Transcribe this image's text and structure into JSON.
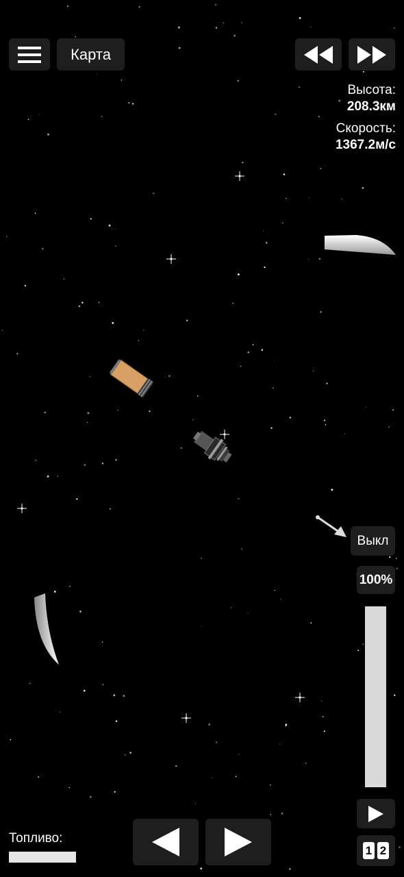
{
  "toolbar": {
    "menu_icon": "hamburger-menu-icon",
    "map_label": "Карта",
    "rewind_icon": "rewind-icon",
    "fast_forward_icon": "fast-forward-icon"
  },
  "telemetry": {
    "altitude_label": "Высота:",
    "altitude_value": "208.3км",
    "speed_label": "Скорость:",
    "speed_value": "1367.2м/с"
  },
  "controls": {
    "toggle_label": "Выкл",
    "throttle_label": "100%",
    "throttle_level": 1.0,
    "play_icon": "play-icon",
    "stage_digits": [
      "1",
      "2"
    ],
    "rotate_left_icon": "rotate-left-arrow-icon",
    "rotate_right_icon": "rotate-right-arrow-icon"
  },
  "fuel": {
    "label": "Топливо:",
    "level": 1.0
  },
  "colors": {
    "background": "#000000",
    "button_bg": "#1e1e1e",
    "throttle_fill": "#d9d9d9",
    "fuel_tank": "#d9a066"
  }
}
